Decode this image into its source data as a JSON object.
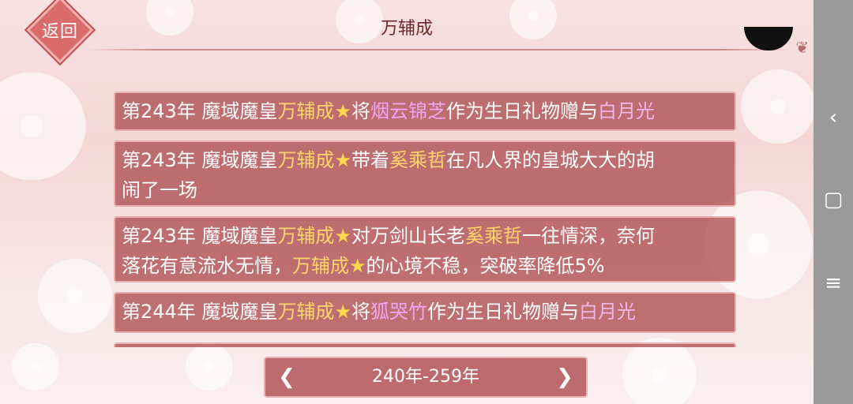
{
  "header": {
    "back_label": "返回",
    "title": "万辅成"
  },
  "entries": [
    {
      "text_first": "第243年 魔域魔皇",
      "name": "万辅成",
      "star": "★",
      "mid": "将",
      "item": "烟云锦芝",
      "rest": "作为生日礼物赠与",
      "target": "白月光"
    },
    {
      "line1_prefix": "第243年 魔域魔皇",
      "name": "万辅成",
      "star": "★",
      "mid": "带着",
      "partner": "奚乘哲",
      "rest1": "在凡人界的皇城大大的胡",
      "rest2": "闹了一场"
    },
    {
      "line1_prefix": "第243年 魔域魔皇",
      "name": "万辅成",
      "star": "★",
      "mid": "对万剑山长老",
      "partner": "奚乘哲",
      "rest1": "一往情深，奈何",
      "line2_prefix": "落花有意流水无情，",
      "name2": "万辅成",
      "star2": "★",
      "rest2": "的心境不稳，突破率降低5%"
    },
    {
      "text_first": "第244年 魔域魔皇",
      "name": "万辅成",
      "star": "★",
      "mid": "将",
      "item": "狐哭竹",
      "rest": "作为生日礼物赠与",
      "target": "白月光"
    }
  ],
  "pager": {
    "label": "240年-259年"
  },
  "colors": {
    "entry_bg": "#b15458",
    "highlight_name": "#ffd66b",
    "highlight_item": "#f0a6f0",
    "star": "#ffd94d"
  },
  "sysnav": {
    "back_icon": "chevron-left-icon",
    "home_icon": "square-icon",
    "menu_icon": "hamburger-icon"
  }
}
